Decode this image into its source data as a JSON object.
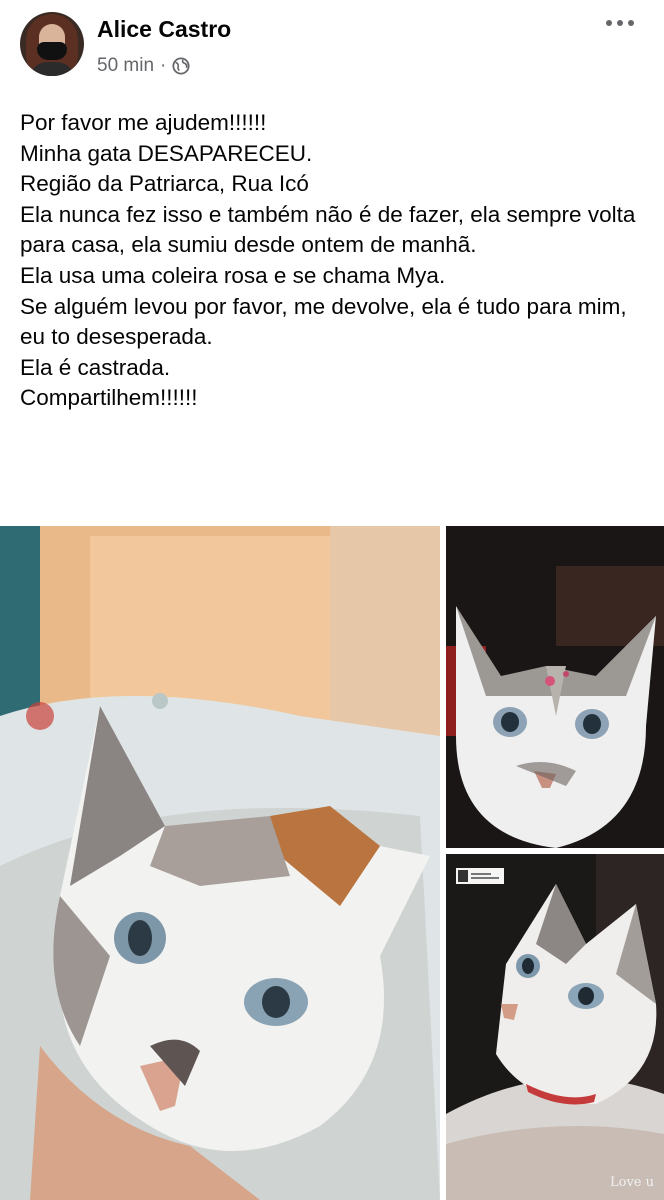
{
  "post": {
    "author": "Alice Castro",
    "timestamp": "50 min",
    "separator": "·",
    "privacy_icon": "globe-icon",
    "menu_icon": "more-horizontal-icon",
    "text_lines": [
      "Por favor me ajudem!!!!!!",
      "Minha gata DESAPARECEU.",
      "Região da Patriarca, Rua Icó",
      "Ela nunca fez isso e também não é de fazer, ela sempre volta para casa, ela sumiu desde ontem de manhã.",
      "Ela usa uma coleira rosa e se chama Mya.",
      "Se alguém levou por favor, me devolve, ela é tudo para mim, eu to desesperada.",
      "Ela é castrada.",
      "Compartilhem!!!!!!"
    ]
  },
  "photos": {
    "bottom_caption": "Love u"
  },
  "colors": {
    "text_primary": "#050505",
    "text_secondary": "#65676b"
  }
}
